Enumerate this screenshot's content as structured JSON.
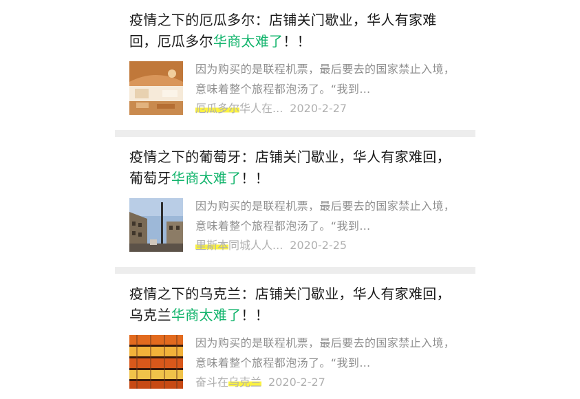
{
  "articles": [
    {
      "title_main": "疫情之下的厄瓜多尔：店铺关门歇业，华人有家难回，厄瓜多尔",
      "title_highlight": "华商太难了",
      "title_end": "！！",
      "excerpt": "因为购买的是联程机票，最后要去的国家禁止入境，意味着整个旅程都泡汤了。“我到…",
      "source_marked": "厄瓜多尔",
      "source_rest": "华人在...",
      "date": "2020-2-27",
      "thumb_icon": "restaurant-interior-photo"
    },
    {
      "title_main": "疫情之下的葡萄牙：店铺关门歇业，华人有家难回，葡萄牙",
      "title_highlight": "华商太难了",
      "title_end": "！！",
      "excerpt": "因为购买的是联程机票，最后要去的国家禁止入境，意味着整个旅程都泡汤了。“我到…",
      "source_marked": "里斯本",
      "source_rest": "同城人人...",
      "date": "2020-2-25",
      "thumb_icon": "city-street-photo"
    },
    {
      "title_main": "疫情之下的乌克兰：店铺关门歇业，华人有家难回，乌克兰",
      "title_highlight": "华商太难了",
      "title_end": "！！",
      "excerpt": "因为购买的是联程机票，最后要去的国家禁止入境，意味着整个旅程都泡汤了。“我到…",
      "source_pre": "奋斗在",
      "source_marked": "乌克兰",
      "date": "2020-2-27",
      "thumb_icon": "supermarket-shelves-photo"
    }
  ],
  "colors": {
    "highlight_green": "#12b46c",
    "title_text": "#1a1a1a",
    "muted_text": "#8f8f8f",
    "marker_yellow": "#faf01e"
  }
}
